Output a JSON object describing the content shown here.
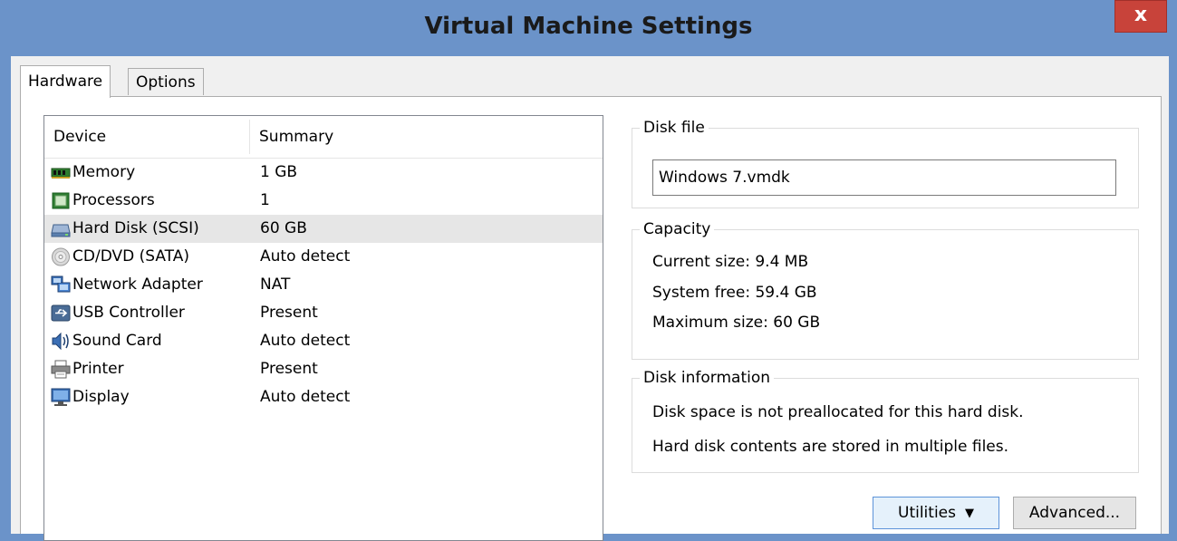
{
  "window": {
    "title": "Virtual Machine Settings",
    "close_label": "x"
  },
  "tabs": [
    {
      "label": "Hardware",
      "active": true
    },
    {
      "label": "Options",
      "active": false
    }
  ],
  "device_list": {
    "columns": [
      "Device",
      "Summary"
    ],
    "rows": [
      {
        "name": "Memory",
        "summary": "1 GB",
        "icon": "memory-icon",
        "selected": false
      },
      {
        "name": "Processors",
        "summary": "1",
        "icon": "processor-icon",
        "selected": false
      },
      {
        "name": "Hard Disk (SCSI)",
        "summary": "60 GB",
        "icon": "hard-disk-icon",
        "selected": true
      },
      {
        "name": "CD/DVD (SATA)",
        "summary": "Auto detect",
        "icon": "cd-dvd-icon",
        "selected": false
      },
      {
        "name": "Network Adapter",
        "summary": "NAT",
        "icon": "network-adapter-icon",
        "selected": false
      },
      {
        "name": "USB Controller",
        "summary": "Present",
        "icon": "usb-icon",
        "selected": false
      },
      {
        "name": "Sound Card",
        "summary": "Auto detect",
        "icon": "sound-card-icon",
        "selected": false
      },
      {
        "name": "Printer",
        "summary": "Present",
        "icon": "printer-icon",
        "selected": false
      },
      {
        "name": "Display",
        "summary": "Auto detect",
        "icon": "display-icon",
        "selected": false
      }
    ]
  },
  "disk_file": {
    "legend": "Disk file",
    "value": "Windows 7.vmdk"
  },
  "capacity": {
    "legend": "Capacity",
    "current_size": "Current size: 9.4 MB",
    "system_free": "System free: 59.4 GB",
    "maximum_size": "Maximum size: 60 GB"
  },
  "disk_information": {
    "legend": "Disk information",
    "line1": "Disk space is not preallocated for this hard disk.",
    "line2": "Hard disk contents are stored in multiple files."
  },
  "buttons": {
    "utilities": "Utilities",
    "advanced": "Advanced..."
  },
  "colors": {
    "title_bar": "#6b93c9",
    "close_button": "#c8433a",
    "selected_row": "#e6e6e6"
  }
}
